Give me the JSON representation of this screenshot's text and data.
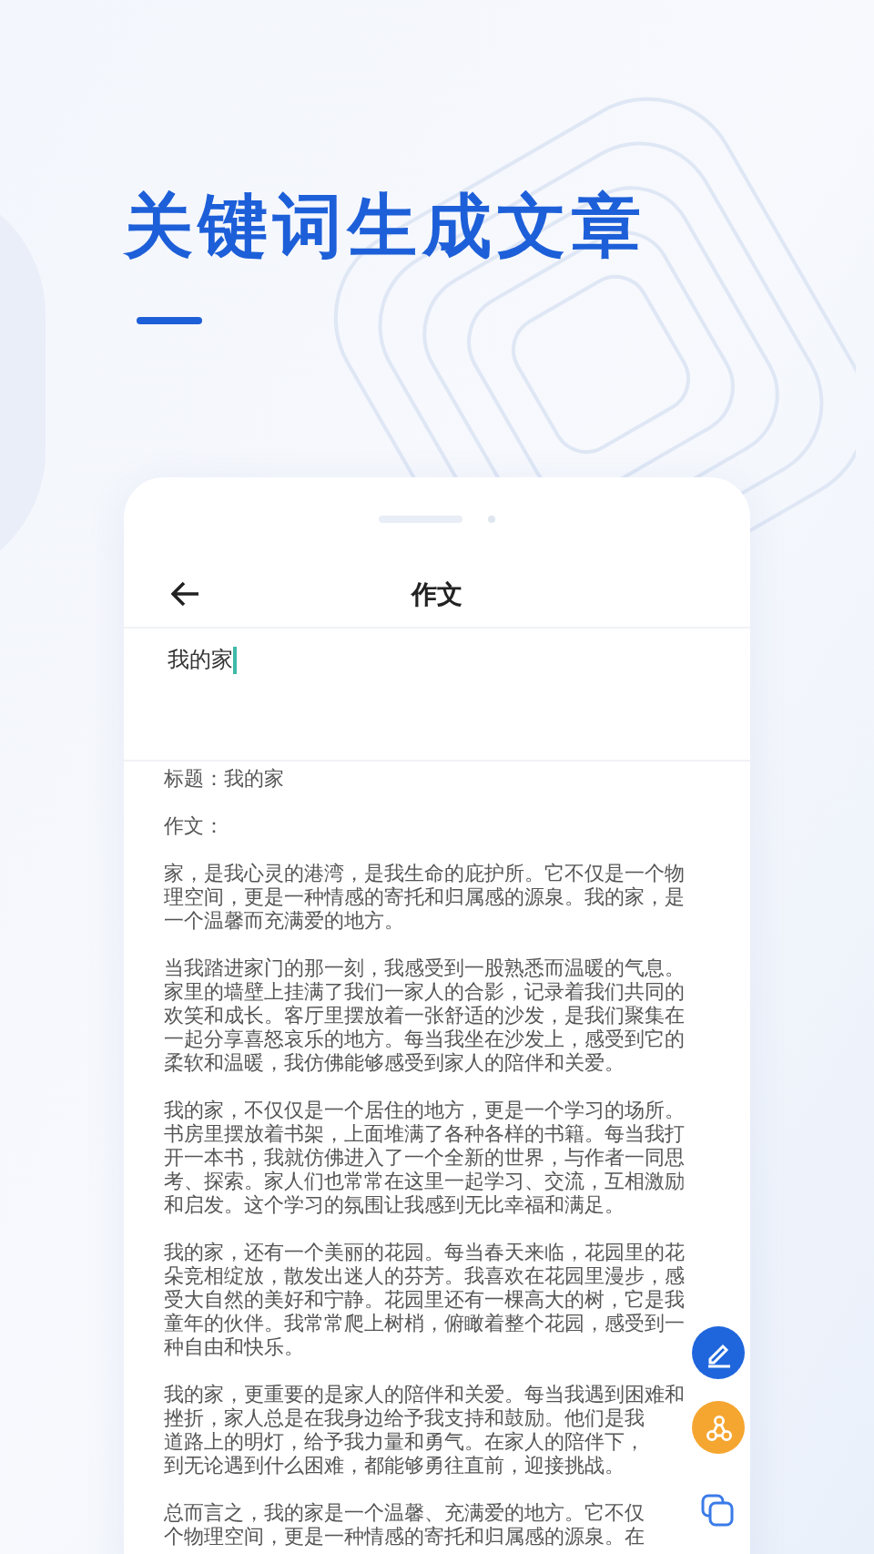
{
  "headline": "关键词生成文章",
  "screen": {
    "title": "作文",
    "input": {
      "value": "我的家"
    },
    "result": [
      [
        "标题：我的家"
      ],
      [
        "作文："
      ],
      [
        "家，是我心灵的港湾，是我生命的庇护所。它不仅是一个物",
        "理空间，更是一种情感的寄托和归属感的源泉。我的家，是",
        "一个温馨而充满爱的地方。"
      ],
      [
        "当我踏进家门的那一刻，我感受到一股熟悉而温暖的气息。",
        "家里的墙壁上挂满了我们一家人的合影，记录着我们共同的",
        "欢笑和成长。客厅里摆放着一张舒适的沙发，是我们聚集在",
        "一起分享喜怒哀乐的地方。每当我坐在沙发上，感受到它的",
        "柔软和温暖，我仿佛能够感受到家人的陪伴和关爱。"
      ],
      [
        "我的家，不仅仅是一个居住的地方，更是一个学习的场所。",
        "书房里摆放着书架，上面堆满了各种各样的书籍。每当我打",
        "开一本书，我就仿佛进入了一个全新的世界，与作者一同思",
        "考、探索。家人们也常常在这里一起学习、交流，互相激励",
        "和启发。这个学习的氛围让我感到无比幸福和满足。"
      ],
      [
        "我的家，还有一个美丽的花园。每当春天来临，花园里的花",
        "朵竞相绽放，散发出迷人的芬芳。我喜欢在花园里漫步，感",
        "受大自然的美好和宁静。花园里还有一棵高大的树，它是我",
        "童年的伙伴。我常常爬上树梢，俯瞰着整个花园，感受到一",
        "种自由和快乐。"
      ],
      [
        "我的家，更重要的是家人的陪伴和关爱。每当我遇到困难和",
        "挫折，家人总是在我身边给予我支持和鼓励。他们是我",
        "道路上的明灯，给予我力量和勇气。在家人的陪伴下，",
        "到无论遇到什么困难，都能够勇往直前，迎接挑战。"
      ],
      [
        "总而言之，我的家是一个温馨、充满爱的地方。它不仅",
        "个物理空间，更是一种情感的寄托和归属感的源泉。在"
      ]
    ]
  }
}
